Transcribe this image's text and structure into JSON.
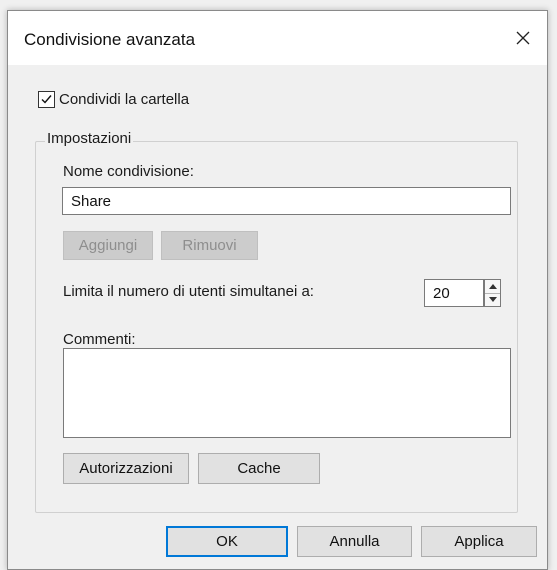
{
  "dialog": {
    "title": "Condivisione avanzata",
    "close_icon": "close-icon"
  },
  "share_checkbox": {
    "label": "Condividi la cartella",
    "checked": true
  },
  "settings": {
    "group_label": "Impostazioni",
    "share_name_label": "Nome condivisione:",
    "share_name_value": "Share",
    "add_label": "Aggiungi",
    "remove_label": "Rimuovi",
    "limit_label": "Limita il numero di utenti simultanei a:",
    "limit_value": "20",
    "comments_label": "Commenti:",
    "comments_value": "",
    "permissions_label": "Autorizzazioni",
    "cache_label": "Cache"
  },
  "footer": {
    "ok_label": "OK",
    "cancel_label": "Annulla",
    "apply_label": "Applica"
  },
  "colors": {
    "focus_border": "#0078d7",
    "window_bg": "#f0f0f0",
    "titlebar_bg": "#ffffff"
  }
}
